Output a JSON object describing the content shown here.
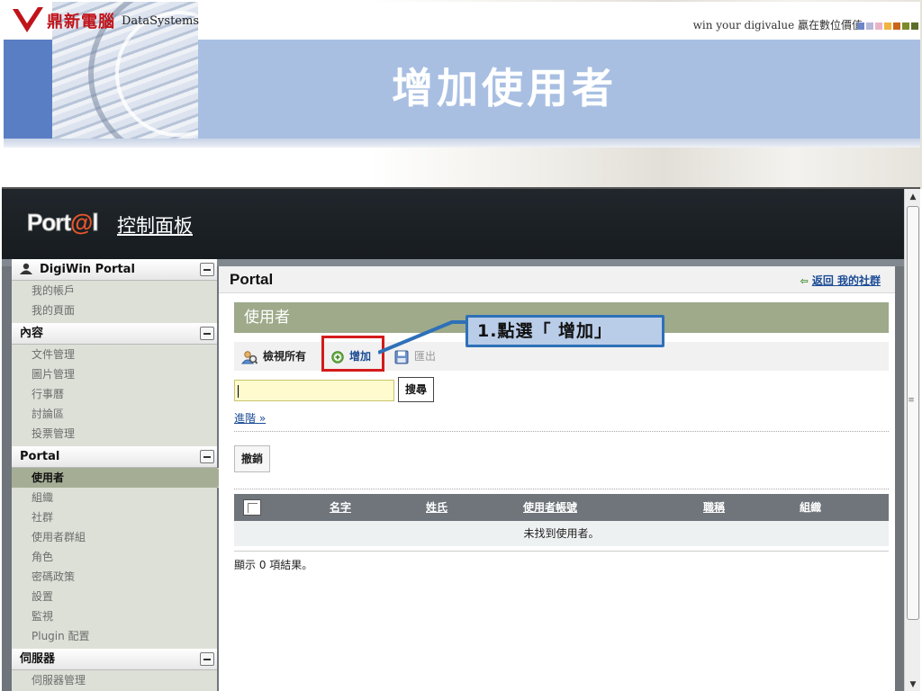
{
  "header": {
    "company_cn": "鼎新電腦",
    "company_en": "DataSystems",
    "tagline": "win your digivalue 贏在數位價值",
    "slide_title": "增加使用者",
    "square_colors": [
      "#6e86c7",
      "#b7b7d9",
      "#e9b3c7",
      "#f0b440",
      "#c9661a",
      "#7b8a2a",
      "#5a6e2a"
    ]
  },
  "dock": {
    "logo_prefix": "Port",
    "logo_at": "@",
    "logo_suffix": "l",
    "control_panel": "控制面板"
  },
  "sidebar": {
    "sections": [
      {
        "title": "DigiWin Portal",
        "items": [
          "我的帳戶",
          "我的頁面"
        ]
      },
      {
        "title": "內容",
        "items": [
          "文件管理",
          "圖片管理",
          "行事曆",
          "討論區",
          "投票管理"
        ]
      },
      {
        "title": "Portal",
        "items": [
          "使用者",
          "組織",
          "社群",
          "使用者群組",
          "角色",
          "密碼政策",
          "設置",
          "監視",
          "Plugin 配置"
        ],
        "active": "使用者"
      },
      {
        "title": "伺服器",
        "items": [
          "伺服器管理"
        ]
      }
    ]
  },
  "main": {
    "portlet_title": "Portal",
    "back_label": "返回 我的社群",
    "section_title": "使用者",
    "toolbar": {
      "view_all": "檢視所有",
      "add": "增加",
      "export": "匯出"
    },
    "search_button": "搜尋",
    "search_value": "",
    "advanced_link": "進階 »",
    "deactivate_button": "撤銷",
    "table_columns": [
      "名字",
      "姓氏",
      "使用者帳號",
      "職稱",
      "組織"
    ],
    "empty_message": "未找到使用者。",
    "result_summary": "顯示 0 項結果。"
  },
  "callout": {
    "text": "1.點選「 增加」"
  },
  "colors": {
    "accent_blue": "#a8bfe2",
    "header_olive": "#9eaa8a",
    "highlight_red": "#d41b1b",
    "callout_border": "#2e70b8"
  }
}
